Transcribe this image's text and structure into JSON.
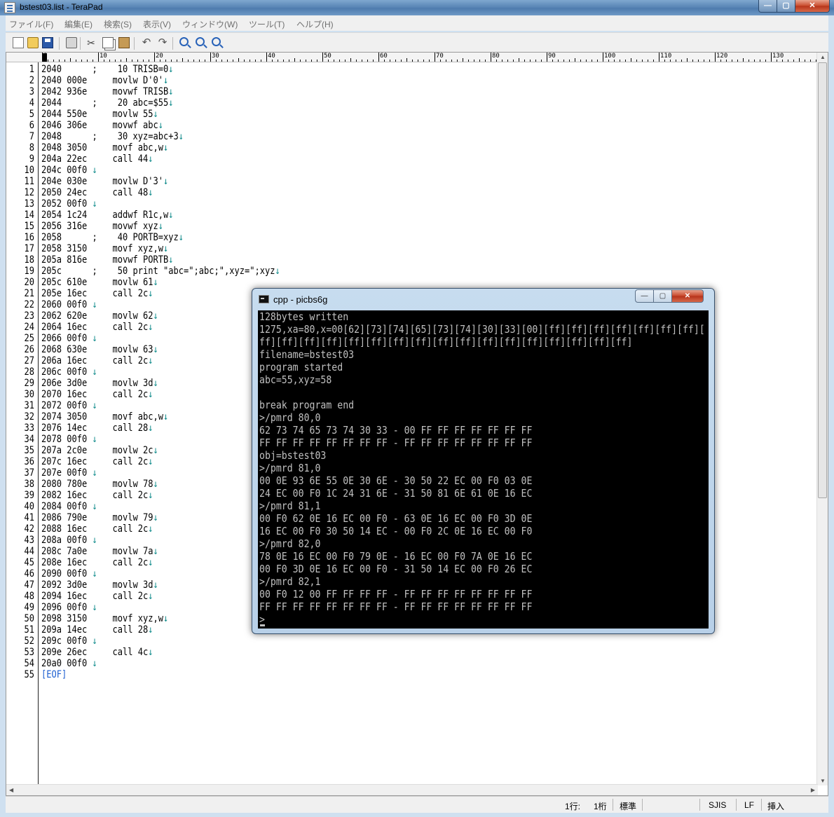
{
  "window": {
    "title": "bstest03.list - TeraPad"
  },
  "menu": [
    "ファイル(F)",
    "編集(E)",
    "検索(S)",
    "表示(V)",
    "ウィンドウ(W)",
    "ツール(T)",
    "ヘルプ(H)"
  ],
  "toolbar": [
    {
      "name": "new-file-icon"
    },
    {
      "name": "open-folder-icon"
    },
    {
      "name": "save-icon"
    },
    {
      "name": "print-icon"
    },
    {
      "name": "cut-icon"
    },
    {
      "name": "copy-icon"
    },
    {
      "name": "paste-icon"
    },
    {
      "name": "undo-icon"
    },
    {
      "name": "redo-icon"
    },
    {
      "name": "find-icon"
    },
    {
      "name": "find-next-icon"
    },
    {
      "name": "find-prev-icon"
    }
  ],
  "ruler": [
    "0",
    "10",
    "20",
    "30",
    "40",
    "50",
    "60",
    "70",
    "80",
    "90",
    "100",
    "110",
    "120",
    "130"
  ],
  "lines": [
    {
      "n": "1",
      "t": "2040      ;    10 TRISB=0",
      "a": true
    },
    {
      "n": "2",
      "t": "2040 000e     movlw D'0'",
      "a": true
    },
    {
      "n": "3",
      "t": "2042 936e     movwf TRISB",
      "a": true
    },
    {
      "n": "4",
      "t": "2044      ;    20 abc=$55",
      "a": true
    },
    {
      "n": "5",
      "t": "2044 550e     movlw 55",
      "a": true
    },
    {
      "n": "6",
      "t": "2046 306e     movwf abc",
      "a": true
    },
    {
      "n": "7",
      "t": "2048      ;    30 xyz=abc+3",
      "a": true
    },
    {
      "n": "8",
      "t": "2048 3050     movf abc,w",
      "a": true
    },
    {
      "n": "9",
      "t": "204a 22ec     call 44",
      "a": true
    },
    {
      "n": "10",
      "t": "204c 00f0 ",
      "a": true
    },
    {
      "n": "11",
      "t": "204e 030e     movlw D'3'",
      "a": true
    },
    {
      "n": "12",
      "t": "2050 24ec     call 48",
      "a": true
    },
    {
      "n": "13",
      "t": "2052 00f0 ",
      "a": true
    },
    {
      "n": "14",
      "t": "2054 1c24     addwf R1c,w",
      "a": true
    },
    {
      "n": "15",
      "t": "2056 316e     movwf xyz",
      "a": true
    },
    {
      "n": "16",
      "t": "2058      ;    40 PORTB=xyz",
      "a": true
    },
    {
      "n": "17",
      "t": "2058 3150     movf xyz,w",
      "a": true
    },
    {
      "n": "18",
      "t": "205a 816e     movwf PORTB",
      "a": true
    },
    {
      "n": "19",
      "t": "205c      ;    50 print \"abc=\";abc;\",xyz=\";xyz",
      "a": true
    },
    {
      "n": "20",
      "t": "205c 610e     movlw 61",
      "a": true
    },
    {
      "n": "21",
      "t": "205e 16ec     call 2c",
      "a": true
    },
    {
      "n": "22",
      "t": "2060 00f0 ",
      "a": true
    },
    {
      "n": "23",
      "t": "2062 620e     movlw 62",
      "a": true
    },
    {
      "n": "24",
      "t": "2064 16ec     call 2c",
      "a": true
    },
    {
      "n": "25",
      "t": "2066 00f0 ",
      "a": true
    },
    {
      "n": "26",
      "t": "2068 630e     movlw 63",
      "a": true
    },
    {
      "n": "27",
      "t": "206a 16ec     call 2c",
      "a": true
    },
    {
      "n": "28",
      "t": "206c 00f0 ",
      "a": true
    },
    {
      "n": "29",
      "t": "206e 3d0e     movlw 3d",
      "a": true
    },
    {
      "n": "30",
      "t": "2070 16ec     call 2c",
      "a": true
    },
    {
      "n": "31",
      "t": "2072 00f0 ",
      "a": true
    },
    {
      "n": "32",
      "t": "2074 3050     movf abc,w",
      "a": true
    },
    {
      "n": "33",
      "t": "2076 14ec     call 28",
      "a": true
    },
    {
      "n": "34",
      "t": "2078 00f0 ",
      "a": true
    },
    {
      "n": "35",
      "t": "207a 2c0e     movlw 2c",
      "a": true
    },
    {
      "n": "36",
      "t": "207c 16ec     call 2c",
      "a": true
    },
    {
      "n": "37",
      "t": "207e 00f0 ",
      "a": true
    },
    {
      "n": "38",
      "t": "2080 780e     movlw 78",
      "a": true
    },
    {
      "n": "39",
      "t": "2082 16ec     call 2c",
      "a": true
    },
    {
      "n": "40",
      "t": "2084 00f0 ",
      "a": true
    },
    {
      "n": "41",
      "t": "2086 790e     movlw 79",
      "a": true
    },
    {
      "n": "42",
      "t": "2088 16ec     call 2c",
      "a": true
    },
    {
      "n": "43",
      "t": "208a 00f0 ",
      "a": true
    },
    {
      "n": "44",
      "t": "208c 7a0e     movlw 7a",
      "a": true
    },
    {
      "n": "45",
      "t": "208e 16ec     call 2c",
      "a": true
    },
    {
      "n": "46",
      "t": "2090 00f0 ",
      "a": true
    },
    {
      "n": "47",
      "t": "2092 3d0e     movlw 3d",
      "a": true
    },
    {
      "n": "48",
      "t": "2094 16ec     call 2c",
      "a": true
    },
    {
      "n": "49",
      "t": "2096 00f0 ",
      "a": true
    },
    {
      "n": "50",
      "t": "2098 3150     movf xyz,w",
      "a": true
    },
    {
      "n": "51",
      "t": "209a 14ec     call 28",
      "a": true
    },
    {
      "n": "52",
      "t": "209c 00f0 ",
      "a": true
    },
    {
      "n": "53",
      "t": "209e 26ec     call 4c",
      "a": true
    },
    {
      "n": "54",
      "t": "20a0 00f0 ",
      "a": true
    },
    {
      "n": "55",
      "t": "[EOF]",
      "a": false,
      "eof": true
    }
  ],
  "arrow_glyph": "↓",
  "status": {
    "line": "1行:",
    "col": "1桁",
    "mode": "標準",
    "encoding": "SJIS",
    "newline": "LF",
    "insert": "挿入"
  },
  "console": {
    "title": "cpp - picbs6g",
    "lines": [
      "128bytes written",
      "1275,xa=80,x=00[62][73][74][65][73][74][30][33][00][ff][ff][ff][ff][ff][ff][ff][",
      "ff][ff][ff][ff][ff][ff][ff][ff][ff][ff][ff][ff][ff][ff][ff][ff][ff]",
      "filename=bstest03",
      "program started",
      "abc=55,xyz=58",
      "",
      "break program end",
      ">/pmrd 80,0",
      "62 73 74 65 73 74 30 33 - 00 FF FF FF FF FF FF FF",
      "FF FF FF FF FF FF FF FF - FF FF FF FF FF FF FF FF",
      "obj=bstest03",
      ">/pmrd 81,0",
      "00 0E 93 6E 55 0E 30 6E - 30 50 22 EC 00 F0 03 0E",
      "24 EC 00 F0 1C 24 31 6E - 31 50 81 6E 61 0E 16 EC",
      ">/pmrd 81,1",
      "00 F0 62 0E 16 EC 00 F0 - 63 0E 16 EC 00 F0 3D 0E",
      "16 EC 00 F0 30 50 14 EC - 00 F0 2C 0E 16 EC 00 F0",
      ">/pmrd 82,0",
      "78 0E 16 EC 00 F0 79 0E - 16 EC 00 F0 7A 0E 16 EC",
      "00 F0 3D 0E 16 EC 00 F0 - 31 50 14 EC 00 F0 26 EC",
      ">/pmrd 82,1",
      "00 F0 12 00 FF FF FF FF - FF FF FF FF FF FF FF FF",
      "FF FF FF FF FF FF FF FF - FF FF FF FF FF FF FF FF",
      ">"
    ]
  }
}
